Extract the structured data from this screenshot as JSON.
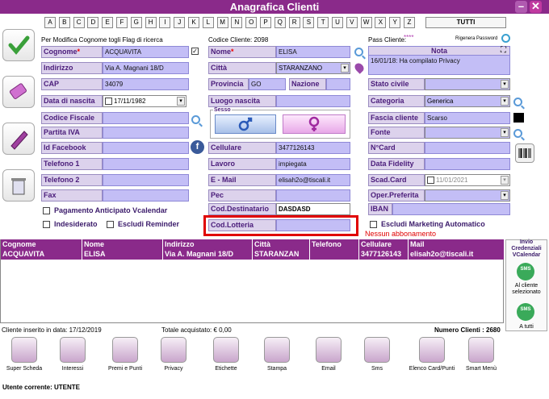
{
  "window": {
    "title": "Anagrafica Clienti",
    "minimize": "–",
    "close": "✕"
  },
  "alphabet": [
    "A",
    "B",
    "C",
    "D",
    "E",
    "F",
    "G",
    "H",
    "I",
    "J",
    "K",
    "L",
    "M",
    "N",
    "O",
    "P",
    "Q",
    "R",
    "S",
    "T",
    "U",
    "V",
    "W",
    "X",
    "Y",
    "Z"
  ],
  "tutti": "TUTTI",
  "info": {
    "note_ricerca": "Per Modifica Cognome togli Flag di ricerca",
    "codice_cliente": "Codice Cliente: 2098",
    "pass_cliente": "Pass Cliente:",
    "pass_mask": "****",
    "rigenera": "Rigenera Password"
  },
  "fields": {
    "cognome": {
      "label": "Cognome",
      "value": "ACQUAVITA",
      "required": "*"
    },
    "indirizzo": {
      "label": "Indirizzo",
      "value": "Via A. Magnani 18/D"
    },
    "cap": {
      "label": "CAP",
      "value": "34079"
    },
    "data_nascita": {
      "label": "Data di nascita",
      "value": "17/11/1982"
    },
    "codice_fiscale": {
      "label": "Codice Fiscale",
      "value": ""
    },
    "partita_iva": {
      "label": "Partita IVA",
      "value": ""
    },
    "id_facebook": {
      "label": "Id Facebook",
      "value": ""
    },
    "telefono1": {
      "label": "Telefono 1",
      "value": ""
    },
    "telefono2": {
      "label": "Telefono 2",
      "value": ""
    },
    "fax": {
      "label": "Fax",
      "value": ""
    },
    "nome": {
      "label": "Nome",
      "value": "ELISA",
      "required": "*"
    },
    "citta": {
      "label": "Città",
      "value": "STARANZANO"
    },
    "provincia": {
      "label": "Provincia",
      "value": "GO"
    },
    "nazione": {
      "label": "Nazione",
      "value": ""
    },
    "luogo_nascita": {
      "label": "Luogo nascita",
      "value": ""
    },
    "sesso": {
      "label": "Sesso"
    },
    "cellulare": {
      "label": "Cellulare",
      "value": "3477126143"
    },
    "lavoro": {
      "label": "Lavoro",
      "value": "impiegata"
    },
    "email": {
      "label": "E - Mail",
      "value": "elisah2o@tiscali.it"
    },
    "pec": {
      "label": "Pec",
      "value": ""
    },
    "cod_destinatario": {
      "label": "Cod.Destinatario",
      "value": "DASDASD"
    },
    "cod_lotteria": {
      "label": "Cod.Lotteria",
      "value": ""
    },
    "nota": {
      "label": "Nota",
      "value": "16/01/18: Ha compilato Privacy"
    },
    "stato_civile": {
      "label": "Stato civile",
      "value": ""
    },
    "categoria": {
      "label": "Categoria",
      "value": "Generica"
    },
    "fascia_cliente": {
      "label": "Fascia cliente",
      "value": "Scarso"
    },
    "fonte": {
      "label": "Fonte",
      "value": ""
    },
    "ncard": {
      "label": "N°Card",
      "value": ""
    },
    "data_fidelity": {
      "label": "Data Fidelity",
      "value": ""
    },
    "scad_card": {
      "label": "Scad.Card",
      "value": "11/01/2021"
    },
    "oper_preferita": {
      "label": "Oper.Preferita",
      "value": ""
    },
    "iban": {
      "label": "IBAN",
      "value": ""
    }
  },
  "checkboxes": {
    "pagamento": "Pagamento Anticipato Vcalendar",
    "indesiderato": "Indesiderato",
    "escludi_reminder": "Escludi Reminder",
    "escludi_marketing": "Escludi Marketing Automatico"
  },
  "nessun_abbonamento": "Nessun abbonamento",
  "table": {
    "headers": [
      "Cognome",
      "Nome",
      "Indirizzo",
      "Città",
      "Telefono",
      "Cellulare",
      "Mail"
    ],
    "rows": [
      [
        "ACQUAVITA",
        "ELISA",
        "Via A. Magnani 18/D",
        "STARANZAN",
        "",
        "3477126143",
        "elisah2o@tiscali.it"
      ]
    ]
  },
  "vcal": {
    "title": "Invio Credenziali VCalendar",
    "sms_icon": "SMS",
    "selected": "Al cliente selezionato",
    "all": "A tutti"
  },
  "status": {
    "inserito": "Cliente inserito in data: 17/12/2019",
    "totale": "Totale acquistato: € 0,00",
    "numero": "Numero Clienti : 2680"
  },
  "toolbar": [
    "Super Scheda",
    "Interessi",
    "Premi e Punti",
    "Privacy",
    "Etichette",
    "Stampa",
    "Email",
    "Sms",
    "Elenco Card/Punti",
    "Smart Menù"
  ],
  "footer": "Utente corrente: UTENTE",
  "colors": {
    "title_bar": "#8a2a8a",
    "field_bg": "#c3bef6",
    "label_bg": "#dcd2ec",
    "highlight": "#e00000"
  }
}
